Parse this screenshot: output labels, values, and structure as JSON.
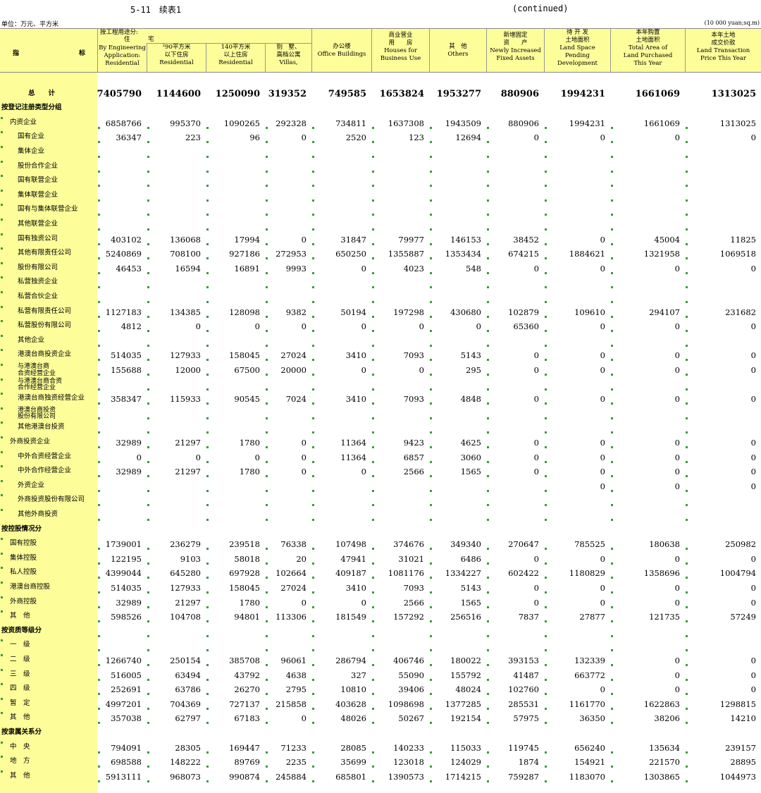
{
  "title": {
    "num": "5-11　续表1",
    "cont": "(continued)"
  },
  "units": {
    "left": "单位：万元、平方米",
    "right": "(10 000 yuan;sq.m)"
  },
  "header": {
    "index_a": "指",
    "index_b": "标",
    "residential_top": [
      "按工程用途分:",
      "住　　　宅"
    ],
    "cols": [
      [
        "By Engineering",
        "Application:",
        "Residential"
      ],
      [
        "²90平方米",
        "以下住房",
        "Residential"
      ],
      [
        "140平方米",
        "以上住房",
        "Residential"
      ],
      [
        "别　墅、",
        "高档公寓",
        "Villas,"
      ],
      [
        "办公楼",
        "Office Buildings"
      ],
      [
        "商业营业",
        "用　　房",
        "Houses for",
        "Business Use"
      ],
      [
        "其　他",
        "Others"
      ],
      [
        "新增固定",
        "资　　产",
        "Newly Increased",
        "Fixed Assets"
      ],
      [
        "待 开 发",
        "土地面积",
        "Land Space",
        "Pending",
        "Development"
      ],
      [
        "本年购置",
        "土地面积",
        "Total Area of",
        "Land Purchased",
        "This Year"
      ],
      [
        "本年土地",
        "成交价款",
        "Land Transaction",
        "Price This Year"
      ]
    ]
  },
  "rows": [
    {
      "label": "",
      "values": []
    },
    {
      "label": "总　　计",
      "total": true,
      "values": [
        "7405790",
        "1144600",
        "1250090",
        "319352",
        "749585",
        "1653824",
        "1953277",
        "880906",
        "1994231",
        "1661069",
        "1313025"
      ]
    },
    {
      "label": "按登记注册类型分组",
      "section": true,
      "values": []
    },
    {
      "label": "内资企业",
      "indent": 0,
      "values": [
        "6858766",
        "995370",
        "1090265",
        "292328",
        "734811",
        "1637308",
        "1943509",
        "880906",
        "1994231",
        "1661069",
        "1313025"
      ]
    },
    {
      "label": "国有企业",
      "indent": 1,
      "values": [
        "36347",
        "223",
        "96",
        "0",
        "2520",
        "123",
        "12694",
        "0",
        "0",
        "0",
        "0"
      ]
    },
    {
      "label": "集体企业",
      "indent": 1,
      "values": []
    },
    {
      "label": "股份合作企业",
      "indent": 1,
      "values": []
    },
    {
      "label": "国有联营企业",
      "indent": 1,
      "values": []
    },
    {
      "label": "集体联营企业",
      "indent": 1,
      "values": []
    },
    {
      "label": "国有与集体联营企业",
      "indent": 1,
      "values": []
    },
    {
      "label": "其他联营企业",
      "indent": 1,
      "values": []
    },
    {
      "label": "国有独资公司",
      "indent": 1,
      "values": [
        "403102",
        "136068",
        "17994",
        "0",
        "31847",
        "79977",
        "146153",
        "38452",
        "0",
        "45004",
        "11825"
      ]
    },
    {
      "label": "其他有限责任公司",
      "indent": 1,
      "values": [
        "5240869",
        "708100",
        "927186",
        "272953",
        "650250",
        "1355887",
        "1353434",
        "674215",
        "1884621",
        "1321958",
        "1069518"
      ]
    },
    {
      "label": "股份有限公司",
      "indent": 1,
      "values": [
        "46453",
        "16594",
        "16891",
        "9993",
        "0",
        "4023",
        "548",
        "0",
        "0",
        "0",
        "0"
      ]
    },
    {
      "label": "私营独资企业",
      "indent": 1,
      "values": []
    },
    {
      "label": "私营合伙企业",
      "indent": 1,
      "values": []
    },
    {
      "label": "私营有限责任公司",
      "indent": 1,
      "values": [
        "1127183",
        "134385",
        "128098",
        "9382",
        "50194",
        "197298",
        "430680",
        "102879",
        "109610",
        "294107",
        "231682"
      ]
    },
    {
      "label": "私营股份有限公司",
      "indent": 1,
      "values": [
        "4812",
        "0",
        "0",
        "0",
        "0",
        "0",
        "0",
        "65360",
        "0",
        "0",
        "0"
      ]
    },
    {
      "label": "其他企业",
      "indent": 1,
      "values": []
    },
    {
      "label": "港澳台商投资企业",
      "indent": 1,
      "values": [
        "514035",
        "127933",
        "158045",
        "27024",
        "3410",
        "7093",
        "5143",
        "0",
        "0",
        "0",
        "0"
      ]
    },
    {
      "label": "与港澳台商\n合资经营企业",
      "indent": 1,
      "small": true,
      "values": [
        "155688",
        "12000",
        "67500",
        "20000",
        "0",
        "0",
        "295",
        "0",
        "0",
        "0",
        "0"
      ]
    },
    {
      "label": "与港澳台商合资\n合作经营企业",
      "indent": 1,
      "small": true,
      "values": []
    },
    {
      "label": "港澳台商独资经营企业",
      "indent": 1,
      "values": [
        "358347",
        "115933",
        "90545",
        "7024",
        "3410",
        "7093",
        "4848",
        "0",
        "0",
        "0",
        "0"
      ]
    },
    {
      "label": "港澳台商投资\n股份有限公司",
      "indent": 1,
      "small": true,
      "values": []
    },
    {
      "label": "其他港澳台投资",
      "indent": 1,
      "values": []
    },
    {
      "label": "外商投资企业",
      "indent": 0,
      "values": [
        "32989",
        "21297",
        "1780",
        "0",
        "11364",
        "9423",
        "4625",
        "0",
        "0",
        "0",
        "0"
      ]
    },
    {
      "label": "中外合资经营企业",
      "indent": 1,
      "values": [
        "0",
        "0",
        "0",
        "0",
        "11364",
        "6857",
        "3060",
        "0",
        "0",
        "0",
        "0"
      ]
    },
    {
      "label": "中外合作经营企业",
      "indent": 1,
      "values": [
        "32989",
        "21297",
        "1780",
        "0",
        "0",
        "2566",
        "1565",
        "0",
        "0",
        "0",
        "0"
      ]
    },
    {
      "label": "外资企业",
      "indent": 1,
      "values": [
        "",
        "",
        "",
        "",
        "",
        "",
        "",
        "",
        "0",
        "0",
        "0"
      ]
    },
    {
      "label": "外商投资股份有限公司",
      "indent": 1,
      "values": []
    },
    {
      "label": "其他外商投资",
      "indent": 1,
      "values": []
    },
    {
      "label": "按控股情况分",
      "section": true,
      "values": []
    },
    {
      "label": "国有控股",
      "indent": 0,
      "values": [
        "1739001",
        "236279",
        "239518",
        "76338",
        "107498",
        "374676",
        "349340",
        "270647",
        "785525",
        "180638",
        "250982"
      ]
    },
    {
      "label": "集体控股",
      "indent": 0,
      "values": [
        "122195",
        "9103",
        "58018",
        "20",
        "47941",
        "31021",
        "6486",
        "0",
        "0",
        "0",
        "0"
      ]
    },
    {
      "label": "私人控股",
      "indent": 0,
      "values": [
        "4399044",
        "645280",
        "697928",
        "102664",
        "409187",
        "1081176",
        "1334227",
        "602422",
        "1180829",
        "1358696",
        "1004794"
      ]
    },
    {
      "label": "港澳台商控股",
      "indent": 0,
      "values": [
        "514035",
        "127933",
        "158045",
        "27024",
        "3410",
        "7093",
        "5143",
        "0",
        "0",
        "0",
        "0"
      ]
    },
    {
      "label": "外商控股",
      "indent": 0,
      "values": [
        "32989",
        "21297",
        "1780",
        "0",
        "0",
        "2566",
        "1565",
        "0",
        "0",
        "0",
        "0"
      ]
    },
    {
      "label": "其　他",
      "indent": 0,
      "values": [
        "598526",
        "104708",
        "94801",
        "113306",
        "181549",
        "157292",
        "256516",
        "7837",
        "27877",
        "121735",
        "57249"
      ]
    },
    {
      "label": "按资质等级分",
      "section": true,
      "values": []
    },
    {
      "label": "一　级",
      "indent": 0,
      "values": []
    },
    {
      "label": "二　级",
      "indent": 0,
      "values": [
        "1266740",
        "250154",
        "385708",
        "96061",
        "286794",
        "406746",
        "180022",
        "393153",
        "132339",
        "0",
        "0"
      ]
    },
    {
      "label": "三　级",
      "indent": 0,
      "values": [
        "516005",
        "63494",
        "43792",
        "4638",
        "327",
        "55090",
        "155792",
        "41487",
        "663772",
        "0",
        "0"
      ]
    },
    {
      "label": "四　级",
      "indent": 0,
      "values": [
        "252691",
        "63786",
        "26270",
        "2795",
        "10810",
        "39406",
        "48024",
        "102760",
        "0",
        "0",
        "0"
      ]
    },
    {
      "label": "暂　定",
      "indent": 0,
      "values": [
        "4997201",
        "704369",
        "727137",
        "215858",
        "403628",
        "1098698",
        "1377285",
        "285531",
        "1161770",
        "1622863",
        "1298815"
      ]
    },
    {
      "label": "其　他",
      "indent": 0,
      "values": [
        "357038",
        "62797",
        "67183",
        "0",
        "48026",
        "50267",
        "192154",
        "57975",
        "36350",
        "38206",
        "14210"
      ]
    },
    {
      "label": "按隶属关系分",
      "section": true,
      "values": []
    },
    {
      "label": "中　央",
      "indent": 0,
      "values": [
        "794091",
        "28305",
        "169447",
        "71233",
        "28085",
        "140233",
        "115033",
        "119745",
        "656240",
        "135634",
        "239157"
      ]
    },
    {
      "label": "地　方",
      "indent": 0,
      "values": [
        "698588",
        "148222",
        "89769",
        "2235",
        "35699",
        "123018",
        "124029",
        "1874",
        "154921",
        "221570",
        "28895"
      ]
    },
    {
      "label": "其　他",
      "indent": 0,
      "values": [
        "5913111",
        "968073",
        "990874",
        "245884",
        "685801",
        "1390573",
        "1714215",
        "759287",
        "1183070",
        "1303865",
        "1044973"
      ]
    }
  ]
}
